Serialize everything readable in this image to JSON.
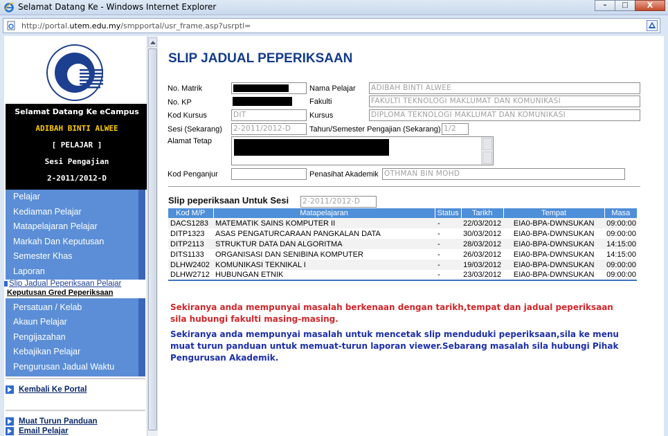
{
  "window": {
    "title": "Selamat Datang Ke - Windows Internet Explorer",
    "url_prefix": "http://portal.",
    "url_domain": "utem.edu.my",
    "url_suffix": "/smpportal/usr_frame.asp?usrptl=",
    "minimize": "–",
    "maximize": "□",
    "close": "X"
  },
  "sidebar": {
    "welcome_line": "Selamat Datang Ke eCampus",
    "student_name": "ADIBAH BINTI ALWEE",
    "role": "[ PELAJAR ]",
    "session_label": "Sesi Pengajian",
    "session_value": "2-2011/2012-D",
    "menu": [
      "Pelajar",
      "Kediaman Pelajar",
      "Matapelajaran Pelajar",
      "Markah Dan Keputusan",
      "Semester Khas",
      "Laporan",
      "Slip Jadual Peperiksaan Pelajar",
      "Keputusan Gred Peperiksaan",
      "Persatuan / Kelab",
      "Akaun Pelajar",
      "Pengijazahan",
      "Kebajikan Pelajar",
      "Pengurusan Jadual Waktu"
    ],
    "link_portal": "Kembali Ke Portal",
    "link_manual": "Muat Turun Panduan",
    "link_email": "Email Pelajar"
  },
  "main": {
    "title": "SLIP JADUAL PEPERIKSAAN",
    "labels": {
      "matrik": "No. Matrik",
      "nama": "Nama Pelajar",
      "kp": "No. KP",
      "fakulti": "Fakulti",
      "kod_kursus": "Kod Kursus",
      "kursus": "Kursus",
      "sesi": "Sesi (Sekarang)",
      "tahun_sem": "Tahun/Semester Pengajian (Sekarang)",
      "alamat": "Alamat Tetap",
      "kod_penganjur": "Kod Penganjur",
      "penasihat": "Penasihat Akademik"
    },
    "values": {
      "nama": "ADIBAH BINTI ALWEE",
      "fakulti": "FAKULTI TEKNOLOGI MAKLUMAT DAN KOMUNIKASI",
      "kod_kursus": "DIT",
      "kursus": "DIPLOMA TEKNOLOGI MAKLUMAT DAN KOMUNIKASI",
      "sesi": "2-2011/2012-D",
      "tahun_sem": "1/2",
      "kod_penganjur": "",
      "penasihat": "OTHMAN BIN MOHD"
    },
    "slip_title": "Slip peperiksaan Untuk Sesi",
    "slip_session": "2-2011/2012-D",
    "table": {
      "headers": [
        "Kod M/P",
        "Matapelajaran",
        "Status",
        "Tarikh",
        "Tempat",
        "Masa"
      ],
      "rows": [
        [
          "DACS1283",
          "MATEMATIK SAINS KOMPUTER II",
          "-",
          "22/03/2012",
          "EIA0-BPA-DWNSUKAN",
          "09:00:00"
        ],
        [
          "DITP1323",
          "ASAS PENGATURCARAAN PANGKALAN DATA",
          "-",
          "30/03/2012",
          "EIA0-BPA-DWNSUKAN",
          "09:00:00"
        ],
        [
          "DITP2113",
          "STRUKTUR DATA DAN ALGORITMA",
          "-",
          "28/03/2012",
          "EIA0-BPA-DWNSUKAN",
          "14:15:00"
        ],
        [
          "DITS1133",
          "ORGANISASI DAN SENIBINA KOMPUTER",
          "-",
          "26/03/2012",
          "EIA0-BPA-DWNSUKAN",
          "14:15:00"
        ],
        [
          "DLHW2402",
          "KOMUNIKASI TEKNIKAL I",
          "-",
          "19/03/2012",
          "EIA0-BPA-DWNSUKAN",
          "09:00:00"
        ],
        [
          "DLHW2712",
          "HUBUNGAN ETNIK",
          "-",
          "23/03/2012",
          "EIA0-BPA-DWNSUKAN",
          "09:00:00"
        ]
      ]
    },
    "note_red": "Sekiranya anda mempunyai masalah berkenaan dengan tarikh,tempat dan jadual peperiksaan sila hubungi fakulti masing-masing.",
    "note_blue": "Sekiranya anda mempunyai masalah untuk mencetak slip menduduki peperiksaan,sila ke menu muat turun panduan untuk memuat-turun laporan viewer.Sebarang masalah sila hubungi Pihak Pengurusan Akademik."
  },
  "colors": {
    "title_blue": "#133b8a",
    "menu_blue": "#5b8ed6",
    "table_header": "#4f8ed8",
    "note_red": "#d0262a",
    "note_blue": "#1c2fa8"
  },
  "icons": {
    "browser": "ie-icon",
    "page": "page-icon",
    "compat": "compatibility-view-icon",
    "logo": "utem-logo",
    "link": "arrow-link-icon"
  }
}
